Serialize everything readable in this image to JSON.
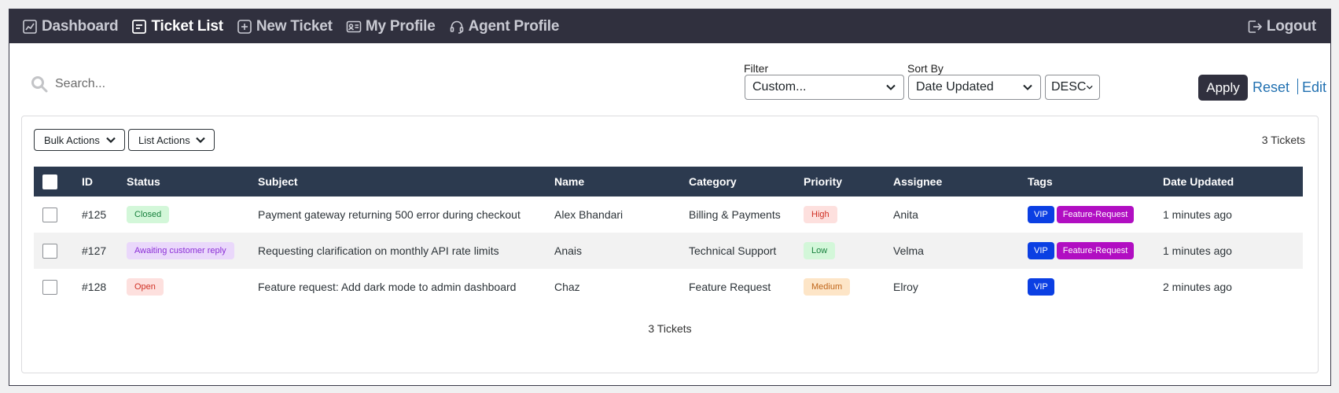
{
  "nav": {
    "items": [
      {
        "label": "Dashboard",
        "icon": "chart-icon"
      },
      {
        "label": "Ticket List",
        "icon": "list-icon"
      },
      {
        "label": "New Ticket",
        "icon": "plus-square-icon"
      },
      {
        "label": "My Profile",
        "icon": "id-card-icon"
      },
      {
        "label": "Agent Profile",
        "icon": "headset-icon"
      }
    ],
    "logout_label": "Logout"
  },
  "toolbar": {
    "search_placeholder": "Search...",
    "filter_label": "Filter",
    "filter_value": "Custom...",
    "sort_label": "Sort By",
    "sort_value": "Date Updated",
    "order_value": "DESC",
    "apply_label": "Apply",
    "reset_label": "Reset",
    "edit_label": "Edit"
  },
  "panel": {
    "bulk_actions_label": "Bulk Actions",
    "list_actions_label": "List Actions",
    "ticket_count": "3 Tickets"
  },
  "table": {
    "headers": [
      "ID",
      "Status",
      "Subject",
      "Name",
      "Category",
      "Priority",
      "Assignee",
      "Tags",
      "Date Updated"
    ],
    "rows": [
      {
        "id": "#125",
        "status": "Closed",
        "subject": "Payment gateway returning 500 error during checkout",
        "name": "Alex Bhandari",
        "category": "Billing & Payments",
        "priority": "High",
        "assignee": "Anita",
        "tags": [
          "VIP",
          "Feature-Request"
        ],
        "date": "1 minutes ago"
      },
      {
        "id": "#127",
        "status": "Awaiting customer reply",
        "subject": "Requesting clarification on monthly API rate limits",
        "name": "Anais",
        "category": "Technical Support",
        "priority": "Low",
        "assignee": "Velma",
        "tags": [
          "VIP",
          "Feature-Request"
        ],
        "date": "1 minutes ago"
      },
      {
        "id": "#128",
        "status": "Open",
        "subject": "Feature request: Add dark mode to admin dashboard",
        "name": "Chaz",
        "category": "Feature Request",
        "priority": "Medium",
        "assignee": "Elroy",
        "tags": [
          "VIP"
        ],
        "date": "2 minutes ago"
      }
    ]
  },
  "colors": {
    "nav_bg": "#30303e",
    "table_header_bg": "#2c3a4f",
    "link": "#2271b1",
    "tag_vip": "#0b3fe3",
    "tag_feature": "#b10ec2"
  }
}
